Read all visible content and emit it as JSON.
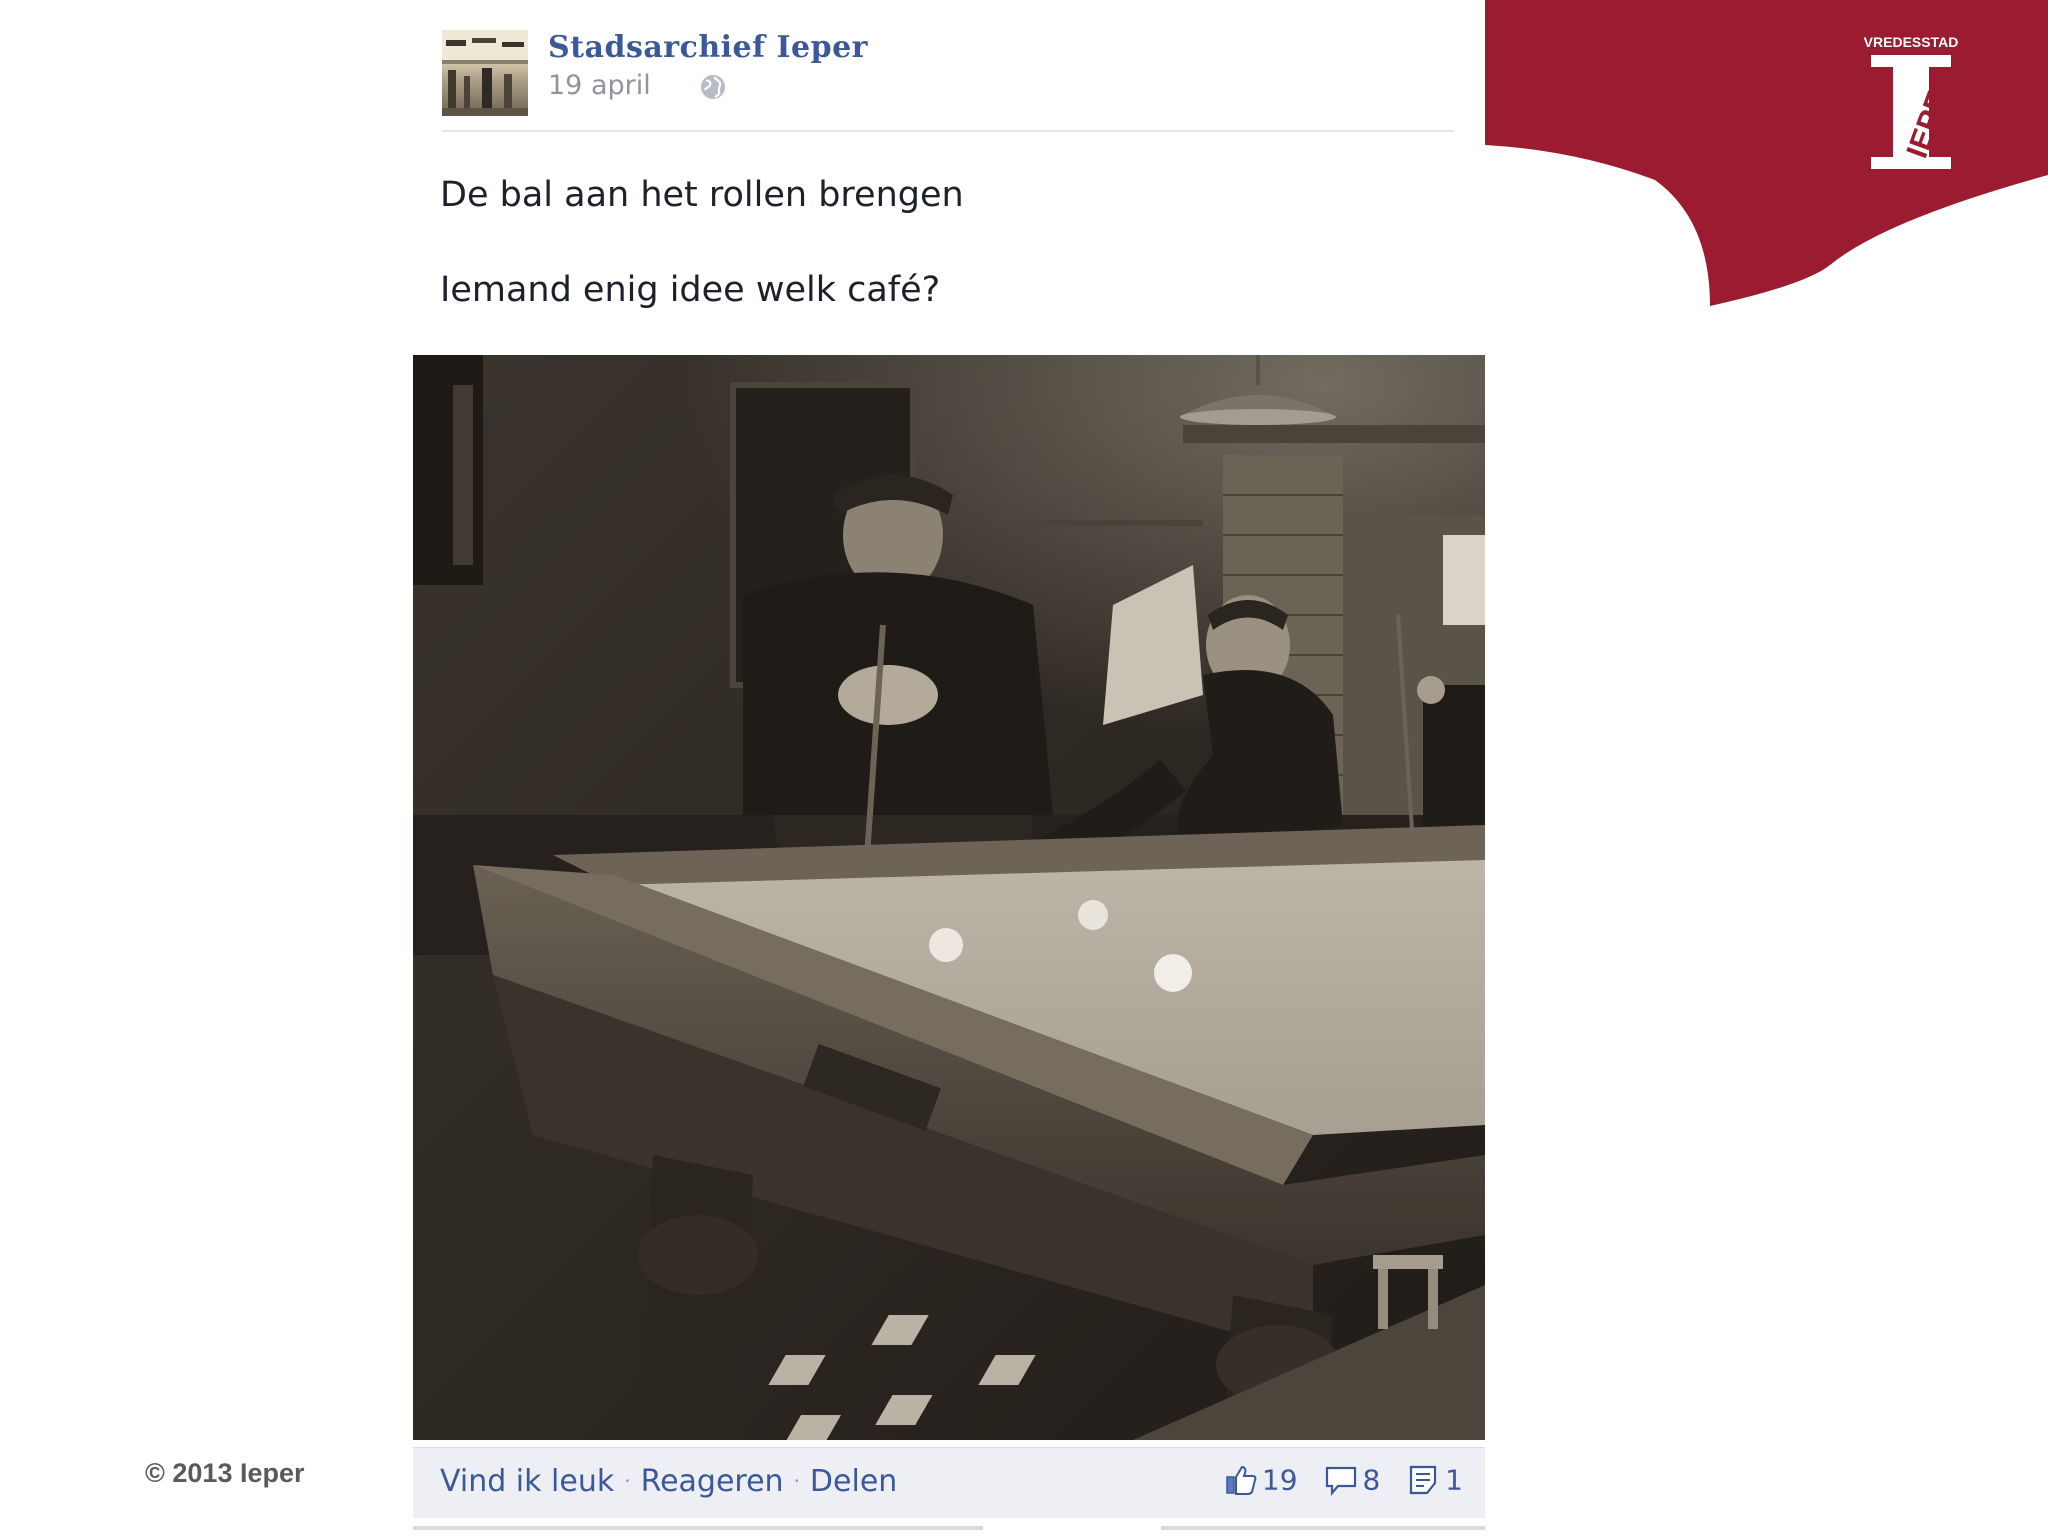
{
  "post": {
    "page_name": "Stadsarchief Ieper",
    "date": "19 april",
    "text_line1": "De bal aan het rollen brengen",
    "text_line2": "Iemand enig idee welk café?"
  },
  "actions": {
    "like": "Vind ik leuk",
    "comment": "Reageren",
    "share": "Delen",
    "separator": "·"
  },
  "counts": {
    "likes": "19",
    "comments": "8",
    "shares": "1"
  },
  "banner": {
    "tagline": "VREDESSTAD",
    "logo_text": "IEPER",
    "color": "#9b1b30"
  },
  "footer": {
    "copyright": "© 2013 Ieper"
  },
  "icons": {
    "privacy": "globe-icon",
    "likes": "thumbs-up-icon",
    "comments": "comment-icon",
    "shares": "share-icon"
  }
}
